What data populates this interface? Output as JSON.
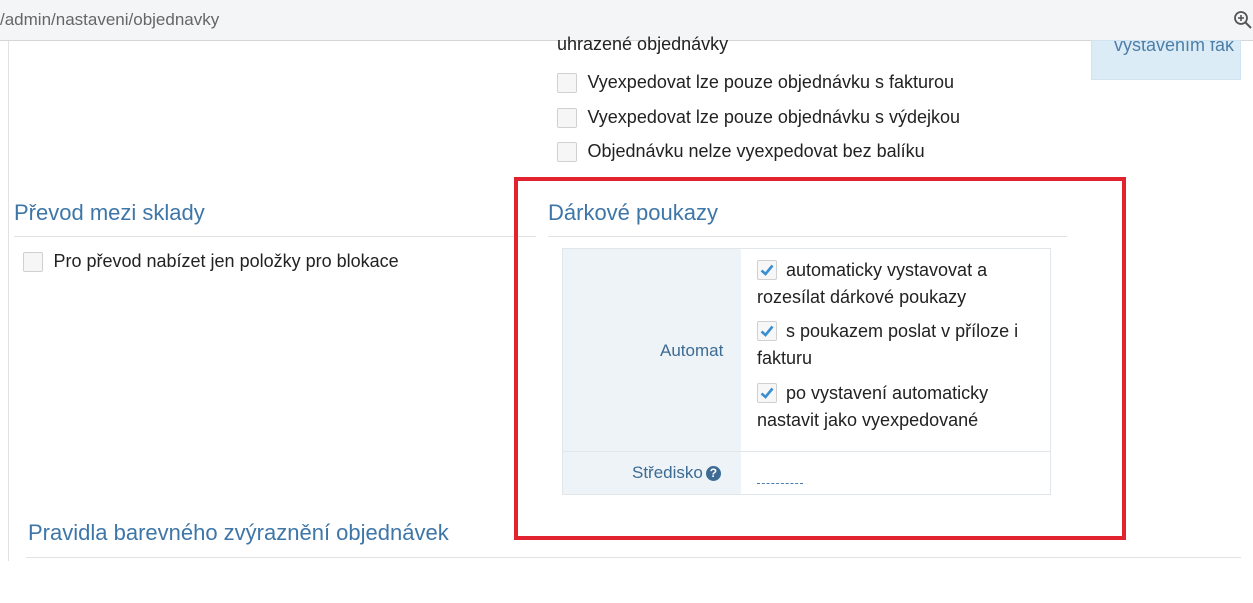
{
  "browser": {
    "url": "/admin/nastaveni/objednavky",
    "zoom_icon": "zoom-icon"
  },
  "expedition": {
    "partial_label": "uhrazené objednávky",
    "options": [
      {
        "label": "Vyexpedovat lze pouze objednávku s fakturou",
        "checked": false
      },
      {
        "label": "Vyexpedovat lze pouze objednávku s výdejkou",
        "checked": false
      },
      {
        "label": "Objednávku nelze vyexpedovat bez balíku",
        "checked": false
      }
    ]
  },
  "info_box": {
    "text": "vystavením fak"
  },
  "transfer": {
    "title": "Převod mezi sklady",
    "options": [
      {
        "label": "Pro převod nabízet jen položky pro blokace",
        "checked": false
      }
    ]
  },
  "gift_vouchers": {
    "title": "Dárkové poukazy",
    "automat_label": "Automat",
    "options": [
      {
        "line1": "automaticky vystavovat a",
        "line2": "rozesílat dárkové poukazy",
        "checked": true
      },
      {
        "line1": "s poukazem poslat v příloze i",
        "line2": "fakturu",
        "checked": true
      },
      {
        "line1": "po vystavení automaticky",
        "line2": "nastavit jako vyexpedované",
        "checked": true
      }
    ],
    "center_label": "Středisko",
    "help_glyph": "?"
  },
  "color_rules": {
    "title": "Pravidla barevného zvýraznění objednávek"
  },
  "colors": {
    "accent": "#3e76a8",
    "highlight": "#e0232e",
    "check": "#3a8fd1"
  }
}
